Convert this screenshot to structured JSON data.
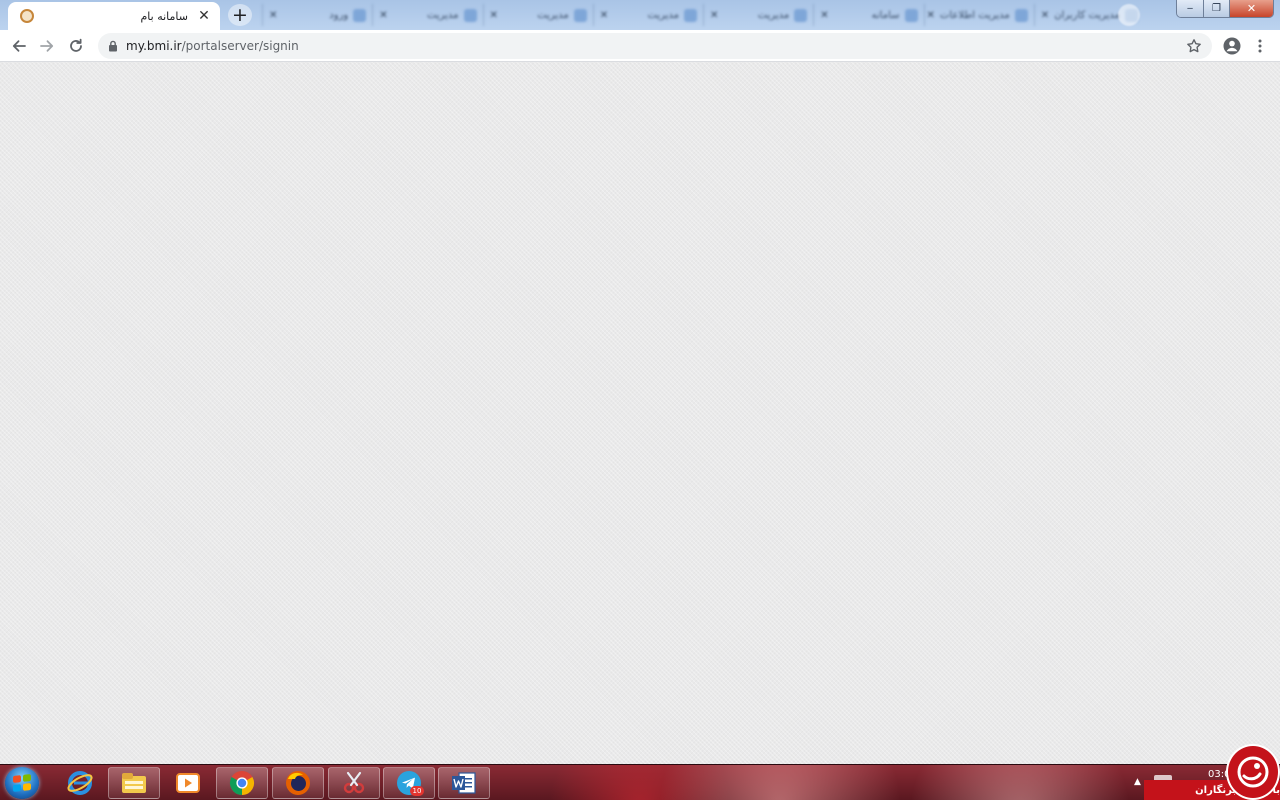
{
  "browser": {
    "active_tab": {
      "title": "سامانه بام",
      "close_glyph": "✕",
      "favicon": "bmi-logo-icon"
    },
    "new_tab_glyph": "+",
    "background_tabs": [
      {
        "label": "مدیریت کاربران",
        "icon": "page-icon"
      },
      {
        "label": "مدیریت اطلاعات",
        "icon": "page-icon"
      },
      {
        "label": "سامانه",
        "icon": "page-icon"
      },
      {
        "label": "مدیریت",
        "icon": "page-icon"
      },
      {
        "label": "مدیریت",
        "icon": "page-icon"
      },
      {
        "label": "مدیریت",
        "icon": "page-icon"
      },
      {
        "label": "مدیریت",
        "icon": "page-icon"
      },
      {
        "label": "ورود",
        "icon": "page-icon"
      }
    ],
    "window_controls": {
      "minimize": "‒",
      "maximize": "❐",
      "close": "✕"
    },
    "address": {
      "host": "my.bmi.ir",
      "path": "/portalserver/signin"
    }
  },
  "taskbar": {
    "apps": [
      {
        "name": "internet-explorer-icon"
      },
      {
        "name": "file-explorer-icon"
      },
      {
        "name": "media-player-icon"
      },
      {
        "name": "chrome-icon"
      },
      {
        "name": "firefox-icon"
      },
      {
        "name": "snipping-tool-icon"
      },
      {
        "name": "telegram-icon",
        "badge": "10"
      },
      {
        "name": "word-icon"
      }
    ],
    "clock": "03:0"
  },
  "watermark": {
    "text": "باشگاه خبرنگاران"
  },
  "colors": {
    "tabstrip": "#a9c4e6",
    "page_background": "#e9e9ea",
    "taskbar": "#7a2430",
    "watermark_red": "#c4121a"
  }
}
